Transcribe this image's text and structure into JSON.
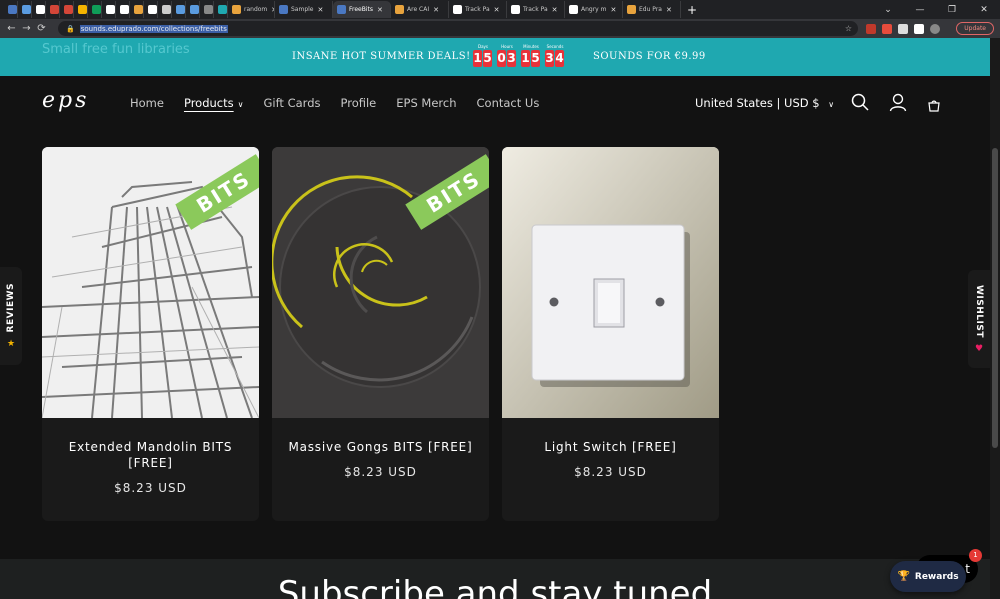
{
  "browser": {
    "tabs": [
      {
        "label": "",
        "color": "#4a78c2"
      },
      {
        "label": "",
        "color": "#5a9be0"
      },
      {
        "label": "",
        "color": "#ffffff"
      },
      {
        "label": "",
        "color": "#d44638"
      },
      {
        "label": "",
        "color": "#d44638"
      },
      {
        "label": "",
        "color": "#f4b400"
      },
      {
        "label": "",
        "color": "#0f9d58"
      },
      {
        "label": "",
        "color": "#ffffff"
      },
      {
        "label": "",
        "color": "#ffffff"
      },
      {
        "label": "",
        "color": "#e8a33d"
      },
      {
        "label": "",
        "color": "#ffffff"
      },
      {
        "label": "",
        "color": "#cccccc"
      },
      {
        "label": "",
        "color": "#5a9be0"
      },
      {
        "label": "",
        "color": "#5a9be0"
      },
      {
        "label": "",
        "color": "#888888"
      },
      {
        "label": "",
        "color": "#1fa8b0"
      },
      {
        "label": "random",
        "color": "#e8a33d"
      },
      {
        "label": "Sample",
        "color": "#4a78c2"
      },
      {
        "label": "FreeBits",
        "color": "#4a78c2",
        "active": true
      },
      {
        "label": "Are CAI",
        "color": "#e8a33d"
      },
      {
        "label": "Track Pa",
        "color": "#ffffff"
      },
      {
        "label": "Track Pa",
        "color": "#ffffff"
      },
      {
        "label": "Angry m",
        "color": "#ffffff"
      },
      {
        "label": "Edu Pra",
        "color": "#e8a33d"
      }
    ],
    "new_tab": "+",
    "url": "sounds.eduprado.com/collections/freebits",
    "update_label": "Update",
    "window_controls": [
      "⌄",
      "—",
      "❐",
      "✕"
    ]
  },
  "announcement": {
    "ghost_text": "Small free fun libraries",
    "left_text": "INSANE HOT SUMMER DEALS!",
    "right_text": "SOUNDS FOR €9.99",
    "countdown": [
      {
        "label": "Days",
        "digits": [
          "1",
          "5"
        ]
      },
      {
        "label": "Hours",
        "digits": [
          "0",
          "3"
        ]
      },
      {
        "label": "Minutes",
        "digits": [
          "1",
          "5"
        ]
      },
      {
        "label": "Seconds",
        "digits": [
          "3",
          "4"
        ]
      }
    ]
  },
  "header": {
    "logo": "eps",
    "nav": [
      {
        "label": "Home"
      },
      {
        "label": "Products",
        "active": true,
        "dropdown": true
      },
      {
        "label": "Gift Cards"
      },
      {
        "label": "Profile"
      },
      {
        "label": "EPS Merch"
      },
      {
        "label": "Contact Us"
      }
    ],
    "locale": "United States | USD $",
    "icons": [
      "search-icon",
      "account-icon",
      "cart-icon"
    ]
  },
  "products": [
    {
      "title": "Extended Mandolin BITS [FREE]",
      "price": "$8.23 USD",
      "badge": "BITS"
    },
    {
      "title": "Massive Gongs BITS [FREE]",
      "price": "$8.23 USD",
      "badge": "BITS"
    },
    {
      "title": "Light Switch [FREE]",
      "price": "$8.23 USD",
      "badge": ""
    }
  ],
  "side_tabs": {
    "reviews": "REVIEWS",
    "wishlist": "WISHLIST"
  },
  "subscribe": {
    "heading": "Subscribe and stay tuned"
  },
  "widgets": {
    "chat_fragment": "t",
    "chat_badge": "1",
    "rewards": "Rewards"
  },
  "colors": {
    "announcement_bg": "#1fa8b0",
    "countdown_digit": "#e8333a",
    "bits_ribbon": "#8bc95b",
    "page_bg": "#121212"
  }
}
